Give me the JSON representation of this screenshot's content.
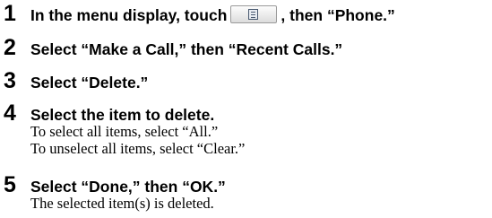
{
  "steps": [
    {
      "number": "1",
      "text_before_icon": "In the menu display, touch",
      "icon": "menu-list-icon",
      "text_after_icon": ", then “Phone.”"
    },
    {
      "number": "2",
      "text": "Select “Make a Call,” then “Recent Calls.”"
    },
    {
      "number": "3",
      "text": "Select “Delete.”"
    },
    {
      "number": "4",
      "text": "Select the item to delete.",
      "details": [
        "To select all items, select “All.”",
        "To unselect all items, select “Clear.”"
      ]
    },
    {
      "number": "5",
      "text": "Select “Done,” then “OK.”",
      "details": [
        "The selected item(s) is deleted."
      ]
    }
  ]
}
